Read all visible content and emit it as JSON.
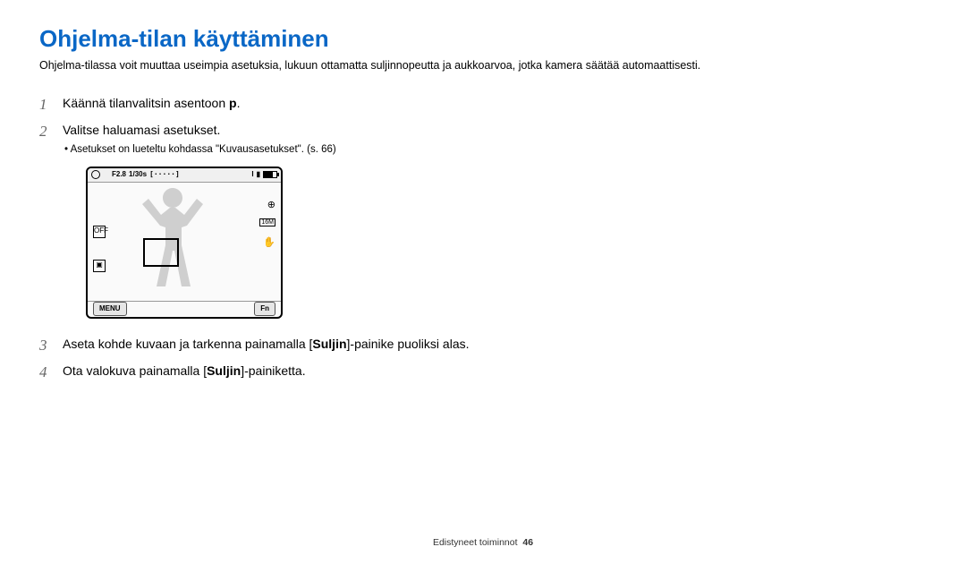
{
  "title": "Ohjelma-tilan käyttäminen",
  "intro": "Ohjelma-tilassa voit muuttaa useimpia asetuksia, lukuun ottamatta suljinnopeutta ja aukkoarvoa, jotka kamera säätää automaattisesti.",
  "steps": {
    "s1_a": "Käännä tilanvalitsin asentoon ",
    "s1_b": "p",
    "s1_c": ".",
    "s2": "Valitse haluamasi asetukset.",
    "s2_sub": "Asetukset on lueteltu kohdassa \"Kuvausasetukset\". (s. 66)",
    "s3_a": "Aseta kohde kuvaan ja tarkenna painamalla [",
    "s3_kw": "Suljin",
    "s3_b": "]-painike puoliksi alas.",
    "s4_a": "Ota valokuva painamalla [",
    "s4_kw": "Suljin",
    "s4_b": "]-painiketta."
  },
  "nums": {
    "n1": "1",
    "n2": "2",
    "n3": "3",
    "n4": "4"
  },
  "cam": {
    "aperture": "F2.8",
    "shutter": "1/30s",
    "quality": "I",
    "menu": "MENU",
    "fn": "Fn",
    "off": "OFF",
    "flash": "⊕",
    "res": "16M",
    "hand": "✋"
  },
  "footer": {
    "section": "Edistyneet toiminnot",
    "page": "46"
  }
}
